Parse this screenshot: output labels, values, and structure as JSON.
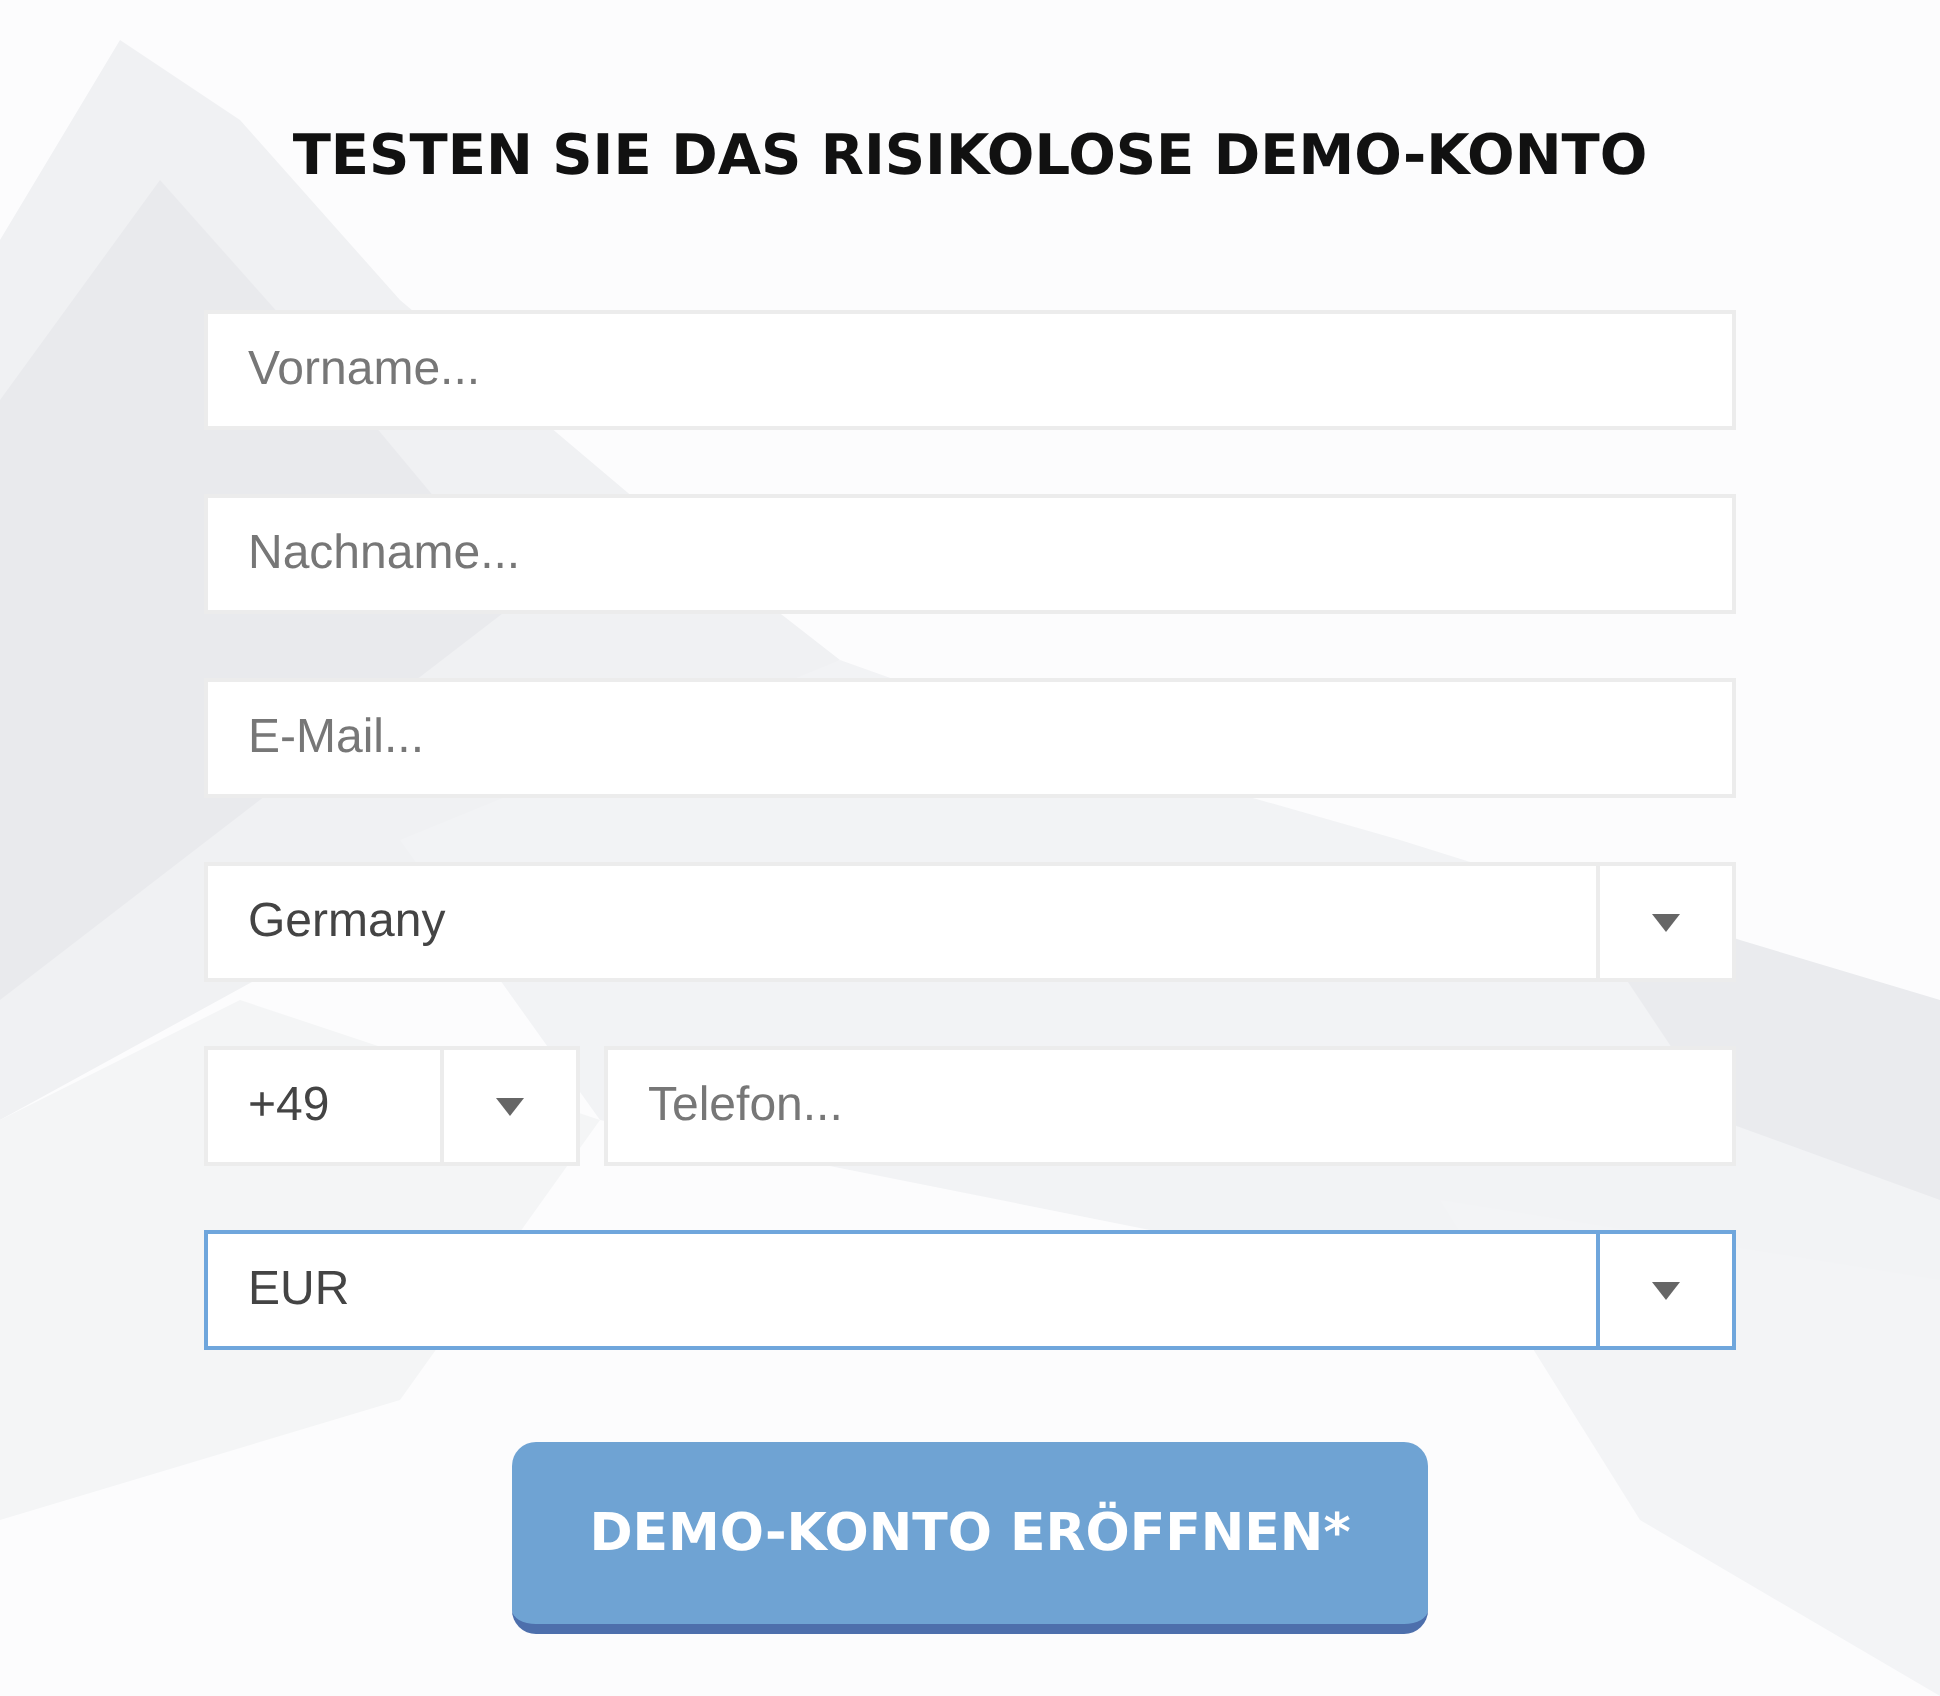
{
  "title": "TESTEN SIE DAS RISIKOLOSE DEMO-KONTO",
  "fields": [
    {
      "kind": "text",
      "placeholder": "Vorname..."
    },
    {
      "kind": "text",
      "placeholder": "Nachname..."
    },
    {
      "kind": "text",
      "placeholder": "E-Mail..."
    },
    {
      "kind": "select",
      "value": "Germany",
      "focused": false
    },
    {
      "kind": "phone",
      "code": "+49",
      "placeholder": "Telefon..."
    },
    {
      "kind": "select",
      "value": "EUR",
      "focused": true
    }
  ],
  "submit": "DEMO-KONTO ERÖFFNEN*"
}
